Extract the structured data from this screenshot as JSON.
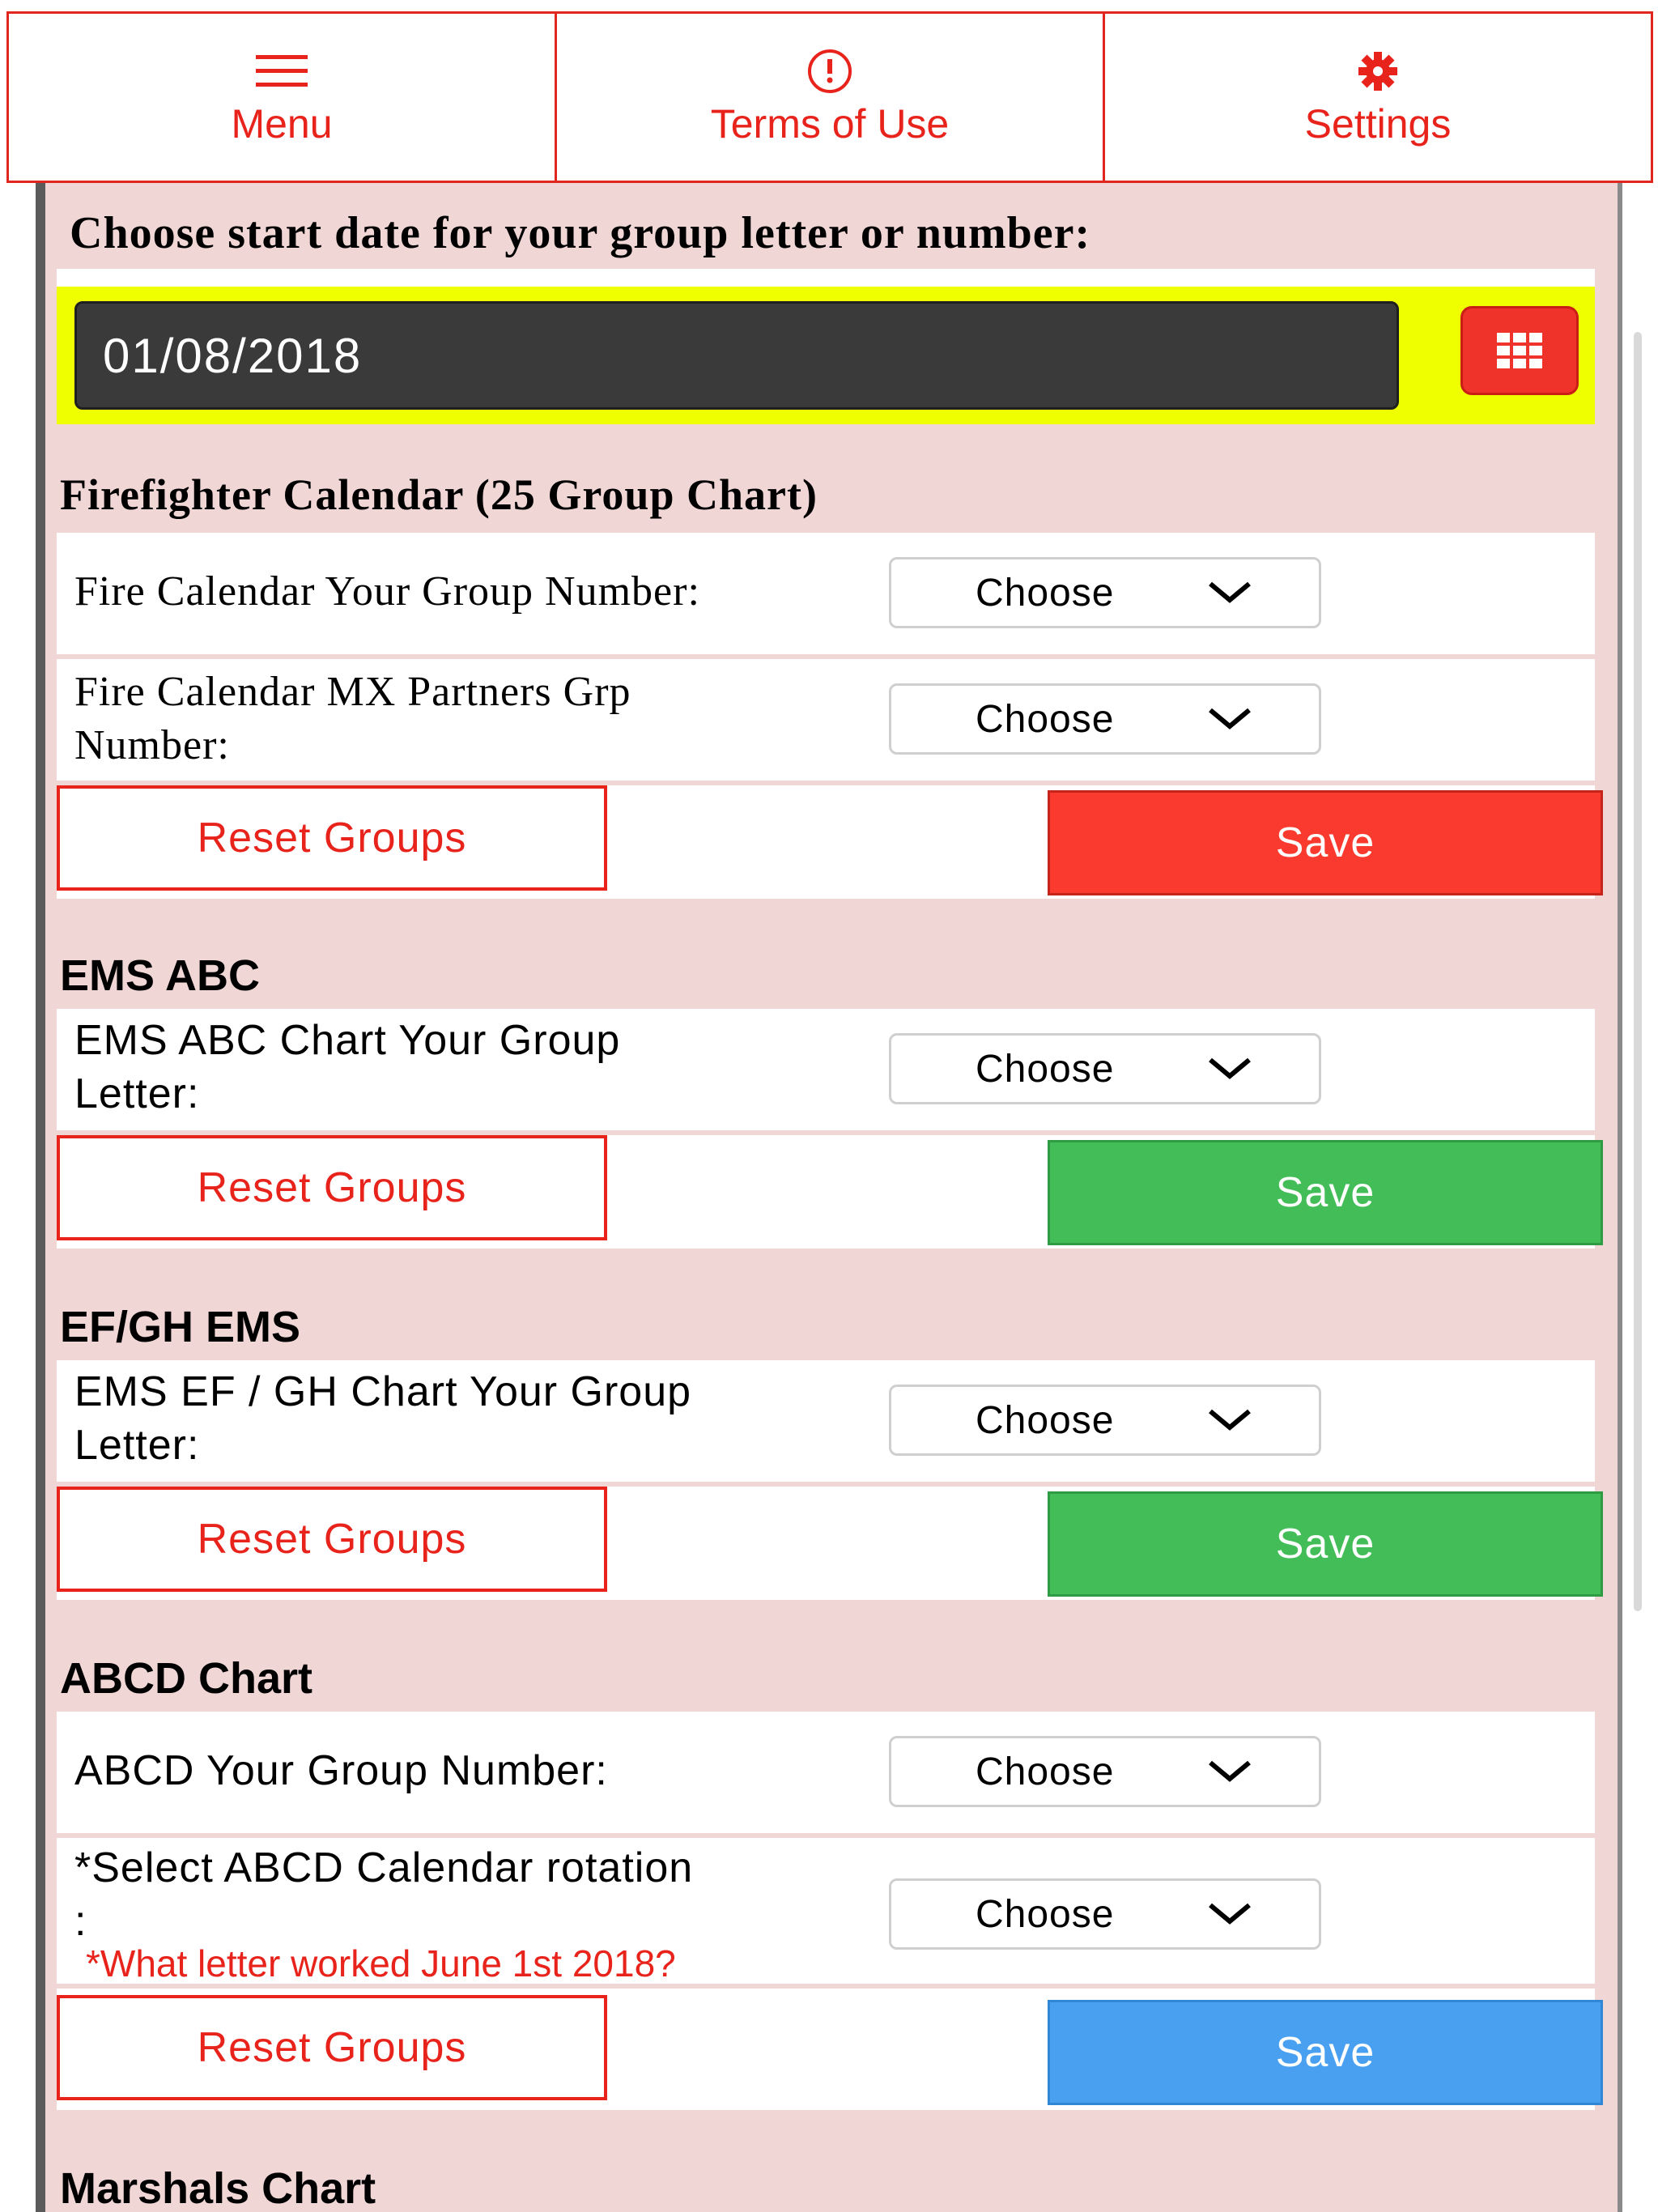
{
  "nav": {
    "menu_label": "Menu",
    "terms_label": "Terms of Use",
    "settings_label": "Settings",
    "accent_color": "#e8231b"
  },
  "start": {
    "label": "Choose start date for your group letter or number:",
    "date_value": "01/08/2018"
  },
  "firefighter": {
    "title": "Firefighter Calendar (25 Group Chart)",
    "group_label": "Fire Calendar Your Group Number:",
    "group_select": "Choose",
    "partners_label_line1": "Fire Calendar MX Partners Grp",
    "partners_label_line2": "Number:",
    "partners_select": "Choose",
    "reset_label": "Reset Groups",
    "save_label": "Save"
  },
  "ems_abc": {
    "title": "EMS ABC",
    "group_label_line1": "EMS ABC Chart Your Group",
    "group_label_line2": "Letter:",
    "group_select": "Choose",
    "reset_label": "Reset Groups",
    "save_label": "Save"
  },
  "efgh": {
    "title": "EF/GH EMS",
    "group_label_line1": "EMS EF / GH Chart Your Group",
    "group_label_line2": "Letter:",
    "group_select": "Choose",
    "reset_label": "Reset Groups",
    "save_label": "Save"
  },
  "abcd": {
    "title": "ABCD Chart",
    "group_label": "ABCD Your Group Number:",
    "group_select": "Choose",
    "rotation_label_line1": "*Select ABCD Calendar rotation",
    "rotation_label_line2": ":",
    "rotation_hint": "*What letter worked June 1st 2018?",
    "rotation_select": "Choose",
    "reset_label": "Reset Groups",
    "save_label": "Save"
  },
  "marshals": {
    "title": "Marshals Chart"
  },
  "colors": {
    "save_red": "#fa3a2e",
    "save_green": "#43bd58",
    "save_blue": "#4aa0f0",
    "date_highlight": "#f0ff00",
    "content_bg": "#f1d6d6"
  }
}
